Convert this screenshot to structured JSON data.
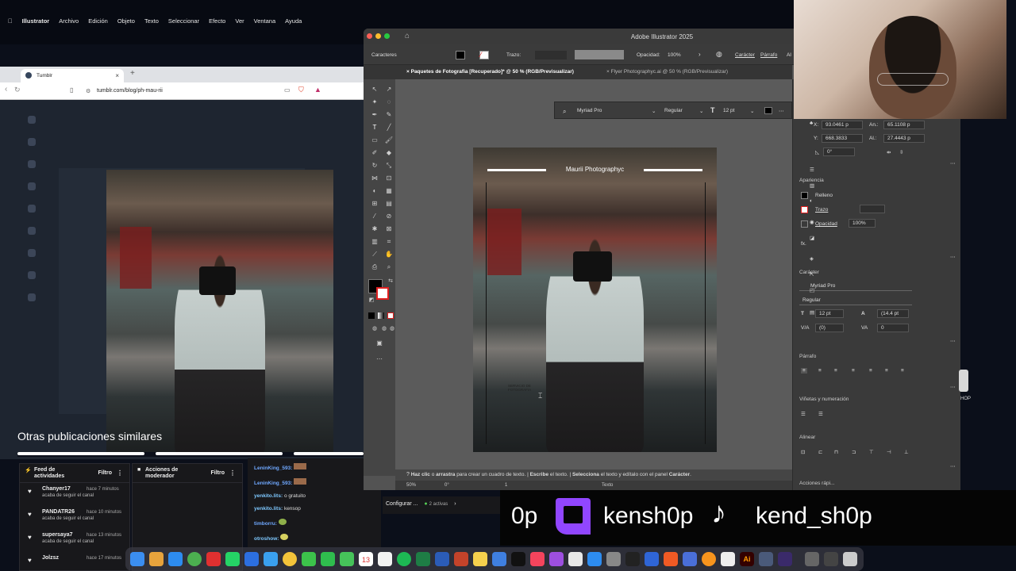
{
  "menubar": {
    "app": "Illustrator",
    "items": [
      "Archivo",
      "Edición",
      "Objeto",
      "Texto",
      "Seleccionar",
      "Efecto",
      "Ver",
      "Ventana",
      "Ayuda"
    ]
  },
  "browser": {
    "tab_title": "Tumblr",
    "url": "tumblr.com/blog/ph-mau-rii"
  },
  "tumblr": {
    "similar_heading": "Otras publicaciones similares"
  },
  "feed_panel": {
    "title": "Feed de actividades",
    "filter": "Filtro",
    "rows": [
      {
        "name": "Chanyer17",
        "time": "hace 7 minutos",
        "sub": "acaba de seguir el canal"
      },
      {
        "name": "PANDATR26",
        "time": "hace 10 minutos",
        "sub": "acaba de seguir el canal"
      },
      {
        "name": "supersaya7",
        "time": "hace 13 minutos",
        "sub": "acaba de seguir el canal"
      },
      {
        "name": "Jolzsz",
        "time": "hace 17 minutos",
        "sub": ""
      }
    ]
  },
  "mod_panel": {
    "title": "Acciones de moderador",
    "filter": "Filtro"
  },
  "chat": {
    "lines": [
      {
        "user": "LeninKing_593:",
        "msg": ""
      },
      {
        "user": "LeninKing_593:",
        "msg": ""
      },
      {
        "user": "yenkito.lits:",
        "msg": "o gratuito"
      },
      {
        "user": "yenkito.lits:",
        "msg": "kensop"
      },
      {
        "user": "timborru:",
        "msg": ""
      },
      {
        "user": "otroshow:",
        "msg": ""
      }
    ],
    "config": "Configurar ...",
    "active": "2 activas"
  },
  "illustrator": {
    "window_title": "Adobe Illustrator 2025",
    "control": {
      "caracteres": "Caracteres",
      "trazo": "Trazo:",
      "opacidad_label": "Opacidad:",
      "opacidad_value": "100%",
      "caracter_link": "Carácter",
      "parrafo_link": "Párrafo",
      "al": "Al"
    },
    "doc_tabs": [
      "Paquetes de Fotografia [Recuperado]* @ 50 % (RGB/Previsualizar)",
      "Flyer Photographyc.ai @ 50 % (RGB/Previsualizar)"
    ],
    "typebar": {
      "font": "Myriad Pro",
      "style": "Regular",
      "size": "12 pt"
    },
    "artboard": {
      "title": "Maurii Photographyc",
      "service": "SERVICIO DE FOTOGRAFIA"
    },
    "status": {
      "p1": "Haz clic",
      "p2": " o ",
      "p3": "arrastra",
      "p4": " para crear un cuadro de texto.  |  ",
      "p5": "Escribe",
      "p6": " el texto.  |  ",
      "p7": "Selecciona",
      "p8": " el texto y edítalo con el panel ",
      "p9": "Carácter",
      "p10": "."
    },
    "bottom": {
      "zoom": "50%",
      "angle": "0°",
      "artboard": "1",
      "tool": "Texto"
    },
    "props": {
      "x_label": "X:",
      "x": "93.0461 p",
      "y_label": "Y:",
      "y": "668.3833",
      "an_label": "An.:",
      "an": "65.1108 p",
      "al_label": "Al.:",
      "al": "27.4443 p",
      "rot": "0°",
      "appearance_title": "Apariencia",
      "relleno": "Relleno",
      "trazo": "Trazo",
      "opacidad": "Opacidad",
      "opacidad_value": "100%",
      "fx": "fx.",
      "caracter_title": "Carácter",
      "font": "Myriad Pro",
      "style": "Regular",
      "size": "12 pt",
      "leading": "(14.4 pt",
      "kerning": "(0)",
      "tracking": "0",
      "parrafo_title": "Párrafo",
      "vinetas_title": "Viñetas y numeración",
      "alinear_title": "Alinear",
      "acciones": "Acciones rápi..."
    }
  },
  "social": {
    "twitch_partial": "0p",
    "twitch": "kensh0p",
    "tiktok": "kend_sh0p",
    "shop_tag": "HOP"
  },
  "dock": {
    "calendar_day": "13"
  },
  "colors": {
    "twitch": "#9146ff",
    "ai_orange": "#ff9a00",
    "ai_bg": "#330000"
  }
}
